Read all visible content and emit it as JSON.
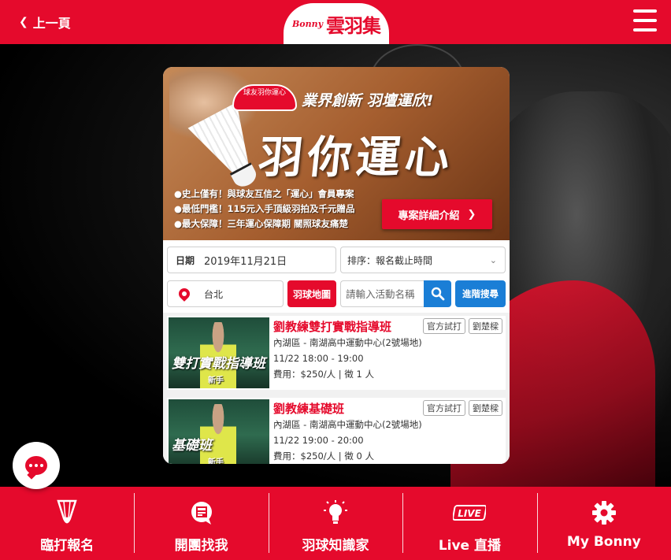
{
  "header": {
    "back_label": "上一頁",
    "logo_small": "Bonny",
    "logo_main": "雲羽集"
  },
  "banner": {
    "badge": "球友羽你運心",
    "slogan": "業界創新 羽壇運欣!",
    "big_title": "羽你運心",
    "bullets": [
      "●史上僅有！與球友互信之「運心」會員專案",
      "●最低門檻！115元入手頂級羽拍及千元贈品",
      "●最大保障！三年運心保障期 關照球友痛楚"
    ],
    "cta_label": "專案詳細介紹"
  },
  "filters": {
    "date_label": "日期",
    "date_value": "2019年11月21日",
    "sort_value": "排序：報名截止時間",
    "city_value": "台北",
    "map_button": "羽球地圖",
    "search_placeholder": "請輸入活動名稱",
    "advanced_button": "進階搜尋"
  },
  "events": [
    {
      "thumb_title": "雙打實戰指導班",
      "thumb_level": "新手",
      "title": "劉教練雙打實戰指導班",
      "tags": [
        "官方試打",
        "劉楚樑"
      ],
      "location": "內湖區 - 南湖高中運動中心(2號場地)",
      "time": "11/22 18:00 - 19:00",
      "fee": "費用：$250/人 | 徵 1 人"
    },
    {
      "thumb_title": "基礎班",
      "thumb_level": "新手",
      "title": "劉教練基礎班",
      "tags": [
        "官方試打",
        "劉楚樑"
      ],
      "location": "內湖區 - 南湖高中運動中心(2號場地)",
      "time": "11/22 19:00 - 20:00",
      "fee": "費用：$250/人 | 徵 0 人"
    }
  ],
  "bottom_nav": [
    {
      "label": "臨打報名",
      "icon": "shuttlecock-icon"
    },
    {
      "label": "開團找我",
      "icon": "chat-board-icon"
    },
    {
      "label": "羽球知識家",
      "icon": "lightbulb-icon"
    },
    {
      "label": "Live 直播",
      "icon": "live-icon"
    },
    {
      "label": "My Bonny",
      "icon": "gear-icon"
    }
  ],
  "colors": {
    "brand_red": "#e50a2c",
    "action_blue": "#1a7ed6"
  }
}
